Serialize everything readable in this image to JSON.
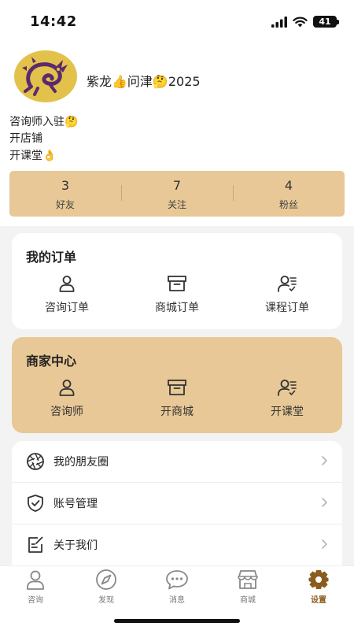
{
  "status_bar": {
    "time": "14:42",
    "battery": "41"
  },
  "profile": {
    "username": "紫龙👍问津🤔2025",
    "bio": [
      "咨询师入驻🤔",
      "开店铺",
      "开课堂👌"
    ],
    "stats": [
      {
        "value": "3",
        "label": "好友"
      },
      {
        "value": "7",
        "label": "关注"
      },
      {
        "value": "4",
        "label": "粉丝"
      }
    ]
  },
  "orders": {
    "title": "我的订单",
    "items": [
      {
        "label": "咨询订单",
        "icon": "person-icon"
      },
      {
        "label": "商城订单",
        "icon": "box-icon"
      },
      {
        "label": "课程订单",
        "icon": "person-list-icon"
      }
    ]
  },
  "merchant": {
    "title": "商家中心",
    "items": [
      {
        "label": "咨询师",
        "icon": "person-icon"
      },
      {
        "label": "开商城",
        "icon": "box-icon"
      },
      {
        "label": "开课堂",
        "icon": "person-list-icon"
      }
    ]
  },
  "menu": [
    {
      "label": "我的朋友圈",
      "icon": "aperture-icon"
    },
    {
      "label": "账号管理",
      "icon": "shield-check-icon"
    },
    {
      "label": "关于我们",
      "icon": "edit-note-icon"
    }
  ],
  "tabs": [
    {
      "label": "咨询",
      "icon": "person-icon",
      "active": false
    },
    {
      "label": "发现",
      "icon": "compass-icon",
      "active": false
    },
    {
      "label": "消息",
      "icon": "chat-bubble-icon",
      "active": false
    },
    {
      "label": "商城",
      "icon": "store-icon",
      "active": false
    },
    {
      "label": "设置",
      "icon": "gear-icon",
      "active": true
    }
  ],
  "colors": {
    "accent": "#e8c896",
    "active_tab": "#8a5c1e",
    "avatar_bg": "#e2c24a",
    "dragon": "#5b2a6e"
  }
}
